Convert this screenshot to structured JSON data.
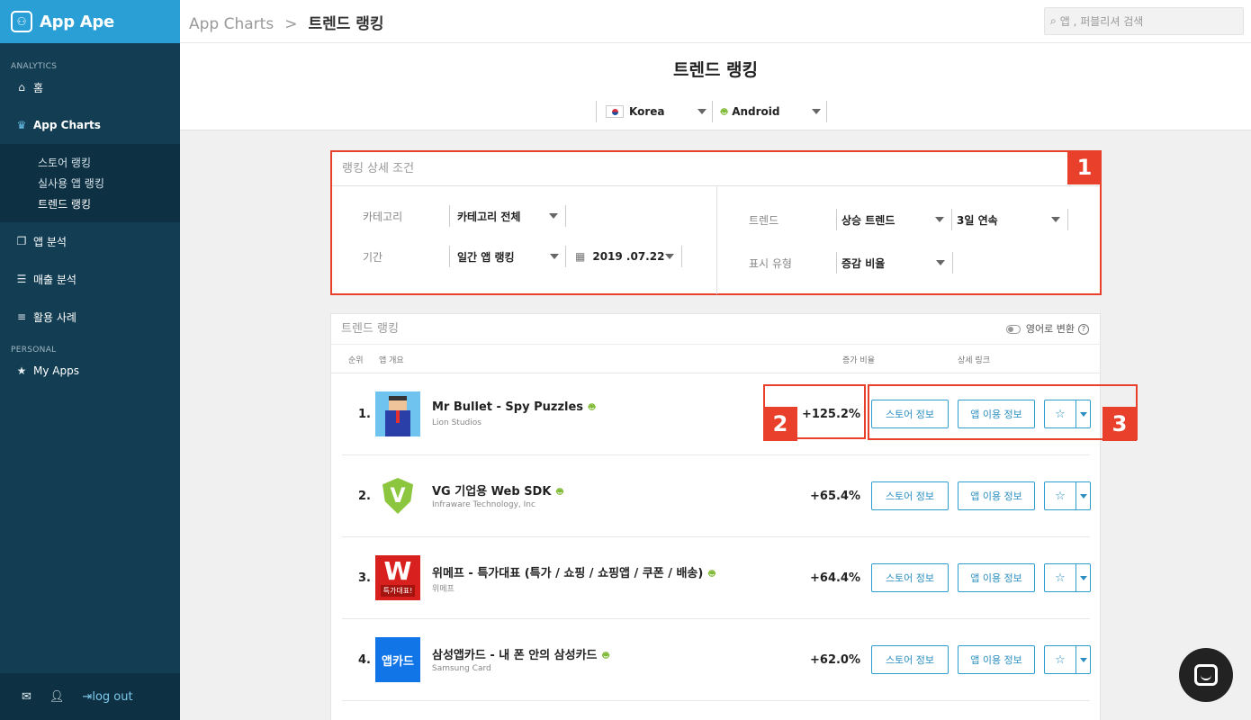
{
  "brand": {
    "name": "App Ape"
  },
  "sidebar": {
    "analytics_label": "ANALYTICS",
    "personal_label": "PERSONAL",
    "items": [
      {
        "label": "홈",
        "icon": "home-icon"
      },
      {
        "label": "App Charts",
        "icon": "trophy-icon"
      },
      {
        "label": "앱 분석",
        "icon": "copy-icon"
      },
      {
        "label": "매출 분석",
        "icon": "database-icon"
      },
      {
        "label": "활용 사례",
        "icon": "list-icon"
      },
      {
        "label": "My Apps",
        "icon": "star-icon"
      }
    ],
    "subitems": [
      "스토어 랭킹",
      "실사용 앱 랭킹",
      "트렌드 랭킹"
    ],
    "footer": {
      "logout": "log out"
    }
  },
  "header": {
    "breadcrumb_root": "App Charts",
    "breadcrumb_sep": ">",
    "breadcrumb_current": "트렌드 랭킹",
    "search_placeholder": "앱 , 퍼블리셔 검색"
  },
  "page": {
    "title": "트렌드 랭킹",
    "country": "Korea",
    "platform": "Android"
  },
  "conditions": {
    "title": "랭킹 상세 조건",
    "category_label": "카테고리",
    "category_value": "카테고리 전체",
    "period_label": "기간",
    "period_value": "일간 앱 랭킹",
    "date_value": "2019 .07.22",
    "trend_label": "트렌드",
    "trend_value": "상승 트렌드",
    "trend_days": "3일 연속",
    "display_label": "표시 유형",
    "display_value": "증감 비율"
  },
  "annotations": {
    "b1": "1",
    "b2": "2",
    "b3": "3"
  },
  "ranking": {
    "title": "트렌드 랭킹",
    "toggle_label": "영어로 변환",
    "col_rank": "순위",
    "col_app": "앱 개요",
    "col_rate": "증가 비율",
    "col_links": "상세 링크",
    "btn_store": "스토어 정보",
    "btn_usage": "앱 이용 정보",
    "rows": [
      {
        "rank": "1.",
        "name": "Mr Bullet - Spy Puzzles",
        "publisher": "Lion Studios",
        "pct": "+125.2%"
      },
      {
        "rank": "2.",
        "name": "VG 기업용 Web SDK",
        "publisher": "Infraware Technology, Inc",
        "pct": "+65.4%",
        "icon_text": "V"
      },
      {
        "rank": "3.",
        "name": "위메프 - 특가대표 (특가 / 쇼핑 / 쇼핑앱 / 쿠폰 / 배송)",
        "publisher": "위메프",
        "pct": "+64.4%",
        "icon_text": "W",
        "icon_sub": "특가대표!"
      },
      {
        "rank": "4.",
        "name": "삼성앱카드 - 내 폰 안의 삼성카드",
        "publisher": "Samsung Card",
        "pct": "+62.0%",
        "icon_text": "앱카드"
      }
    ]
  },
  "colors": {
    "accent": "#2a9fd6",
    "sidebar": "#123d52",
    "highlight": "#e8402a",
    "android": "#7cb82f"
  }
}
